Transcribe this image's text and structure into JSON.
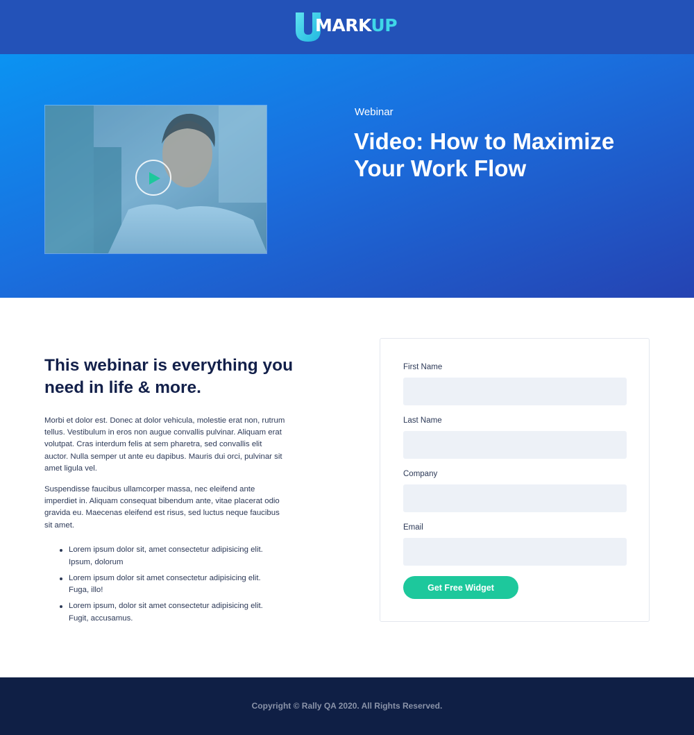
{
  "header": {
    "logo": {
      "letter": "U",
      "text_main": "MARK",
      "text_accent": "UP",
      "colors": {
        "letter": "#3fd7e8",
        "main": "#ffffff",
        "accent": "#3fd7e8"
      }
    },
    "background": "#2352b8"
  },
  "hero": {
    "eyebrow": "Webinar",
    "title": "Video: How to Maximize Your Work Flow",
    "gradient": [
      "#0b93f2",
      "#2543b2"
    ],
    "video": {
      "play_icon": "play-icon",
      "play_color": "#1dc89c"
    }
  },
  "content": {
    "heading": "This webinar is everything you need in life & more.",
    "paragraphs": [
      "Morbi et dolor est. Donec at dolor vehicula, molestie erat non, rutrum tellus. Vestibulum in eros non augue convallis pulvinar. Aliquam erat volutpat. Cras interdum felis at sem pharetra, sed convallis elit auctor. Nulla semper ut ante eu dapibus. Mauris dui orci, pulvinar sit amet ligula vel.",
      "Suspendisse faucibus ullamcorper massa, nec eleifend ante imperdiet in. Aliquam consequat bibendum ante, vitae placerat odio gravida eu. Maecenas eleifend est risus, sed luctus neque faucibus sit amet."
    ],
    "bullets": [
      "Lorem ipsum dolor sit, amet consectetur adipisicing elit. Ipsum, dolorum",
      "Lorem ipsum dolor sit amet consectetur adipisicing elit. Fuga, illo!",
      "Lorem ipsum, dolor sit amet consectetur adipisicing elit. Fugit, accusamus."
    ]
  },
  "form": {
    "fields": [
      {
        "label": "First Name",
        "value": ""
      },
      {
        "label": "Last Name",
        "value": ""
      },
      {
        "label": "Company",
        "value": ""
      },
      {
        "label": "Email",
        "value": ""
      }
    ],
    "submit_label": "Get Free Widget",
    "submit_color": "#1dc89c"
  },
  "footer": {
    "copyright": "Copyright © Rally QA 2020. All Rights Reserved.",
    "background": "#0f1f45"
  }
}
